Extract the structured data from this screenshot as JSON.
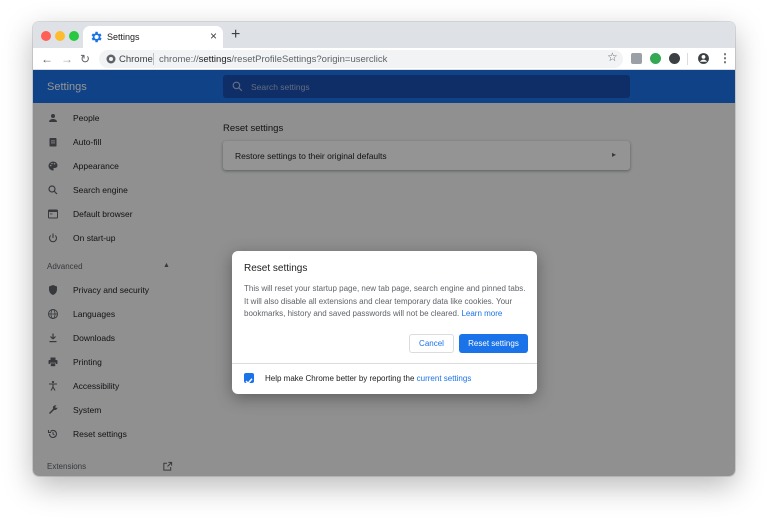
{
  "browser": {
    "tab_title": "Settings",
    "tab_close": "×",
    "new_tab": "+",
    "site_chip": "Chrome",
    "url_prefix": "chrome://",
    "url_host": "settings",
    "url_path": "/resetProfileSettings?origin=userclick"
  },
  "header": {
    "title": "Settings",
    "search_placeholder": "Search settings"
  },
  "sidebar": {
    "items": [
      {
        "label": "People",
        "icon": "person-icon"
      },
      {
        "label": "Auto-fill",
        "icon": "clipboard-icon"
      },
      {
        "label": "Appearance",
        "icon": "palette-icon"
      },
      {
        "label": "Search engine",
        "icon": "search-icon"
      },
      {
        "label": "Default browser",
        "icon": "browser-icon"
      },
      {
        "label": "On start-up",
        "icon": "power-icon"
      }
    ],
    "advanced_label": "Advanced",
    "advanced_items": [
      {
        "label": "Privacy and security",
        "icon": "shield-icon"
      },
      {
        "label": "Languages",
        "icon": "globe-icon"
      },
      {
        "label": "Downloads",
        "icon": "download-icon"
      },
      {
        "label": "Printing",
        "icon": "printer-icon"
      },
      {
        "label": "Accessibility",
        "icon": "accessibility-icon"
      },
      {
        "label": "System",
        "icon": "wrench-icon"
      },
      {
        "label": "Reset settings",
        "icon": "history-icon"
      }
    ],
    "extensions_label": "Extensions"
  },
  "main": {
    "section_title": "Reset settings",
    "card_label": "Restore settings to their original defaults"
  },
  "dialog": {
    "title": "Reset settings",
    "body": "This will reset your startup page, new tab page, search engine and pinned tabs. It will also disable all extensions and clear temporary data like cookies. Your bookmarks, history and saved passwords will not be cleared.",
    "learn_more": "Learn more",
    "cancel_label": "Cancel",
    "reset_label": "Reset settings",
    "checkbox_label": "Help make Chrome better by reporting the",
    "checkbox_link": "current settings",
    "checkbox_checked": true
  },
  "colors": {
    "accent": "#1a73e8",
    "header": "#1a73e8"
  }
}
